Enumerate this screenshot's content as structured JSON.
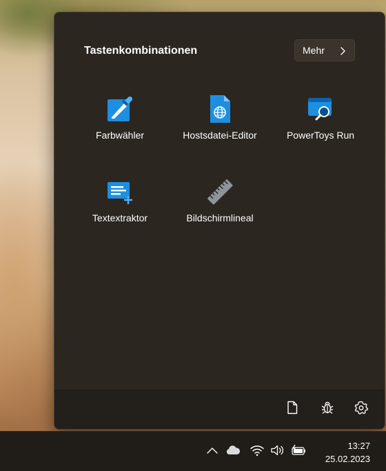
{
  "flyout": {
    "title": "Tastenkombinationen",
    "more_button_label": "Mehr",
    "tools": [
      {
        "label": "Farbwähler",
        "icon": "color-picker-icon"
      },
      {
        "label": "Hostsdatei-Editor",
        "icon": "hosts-file-editor-icon"
      },
      {
        "label": "PowerToys Run",
        "icon": "powertoys-run-icon"
      },
      {
        "label": "Textextraktor",
        "icon": "text-extractor-icon"
      },
      {
        "label": "Bildschirmlineal",
        "icon": "screen-ruler-icon"
      }
    ],
    "footer_icons": [
      "document-icon",
      "bug-icon",
      "settings-icon"
    ]
  },
  "taskbar": {
    "tray_icons": [
      "chevron-up-icon",
      "cloud-icon",
      "wifi-icon",
      "volume-icon",
      "battery-charging-icon"
    ],
    "time": "13:27",
    "date": "25.02.2023"
  },
  "colors": {
    "accent_blue": "#1e8fe0",
    "flyout_bg": "#2b2620",
    "taskbar_bg": "#201c17"
  }
}
